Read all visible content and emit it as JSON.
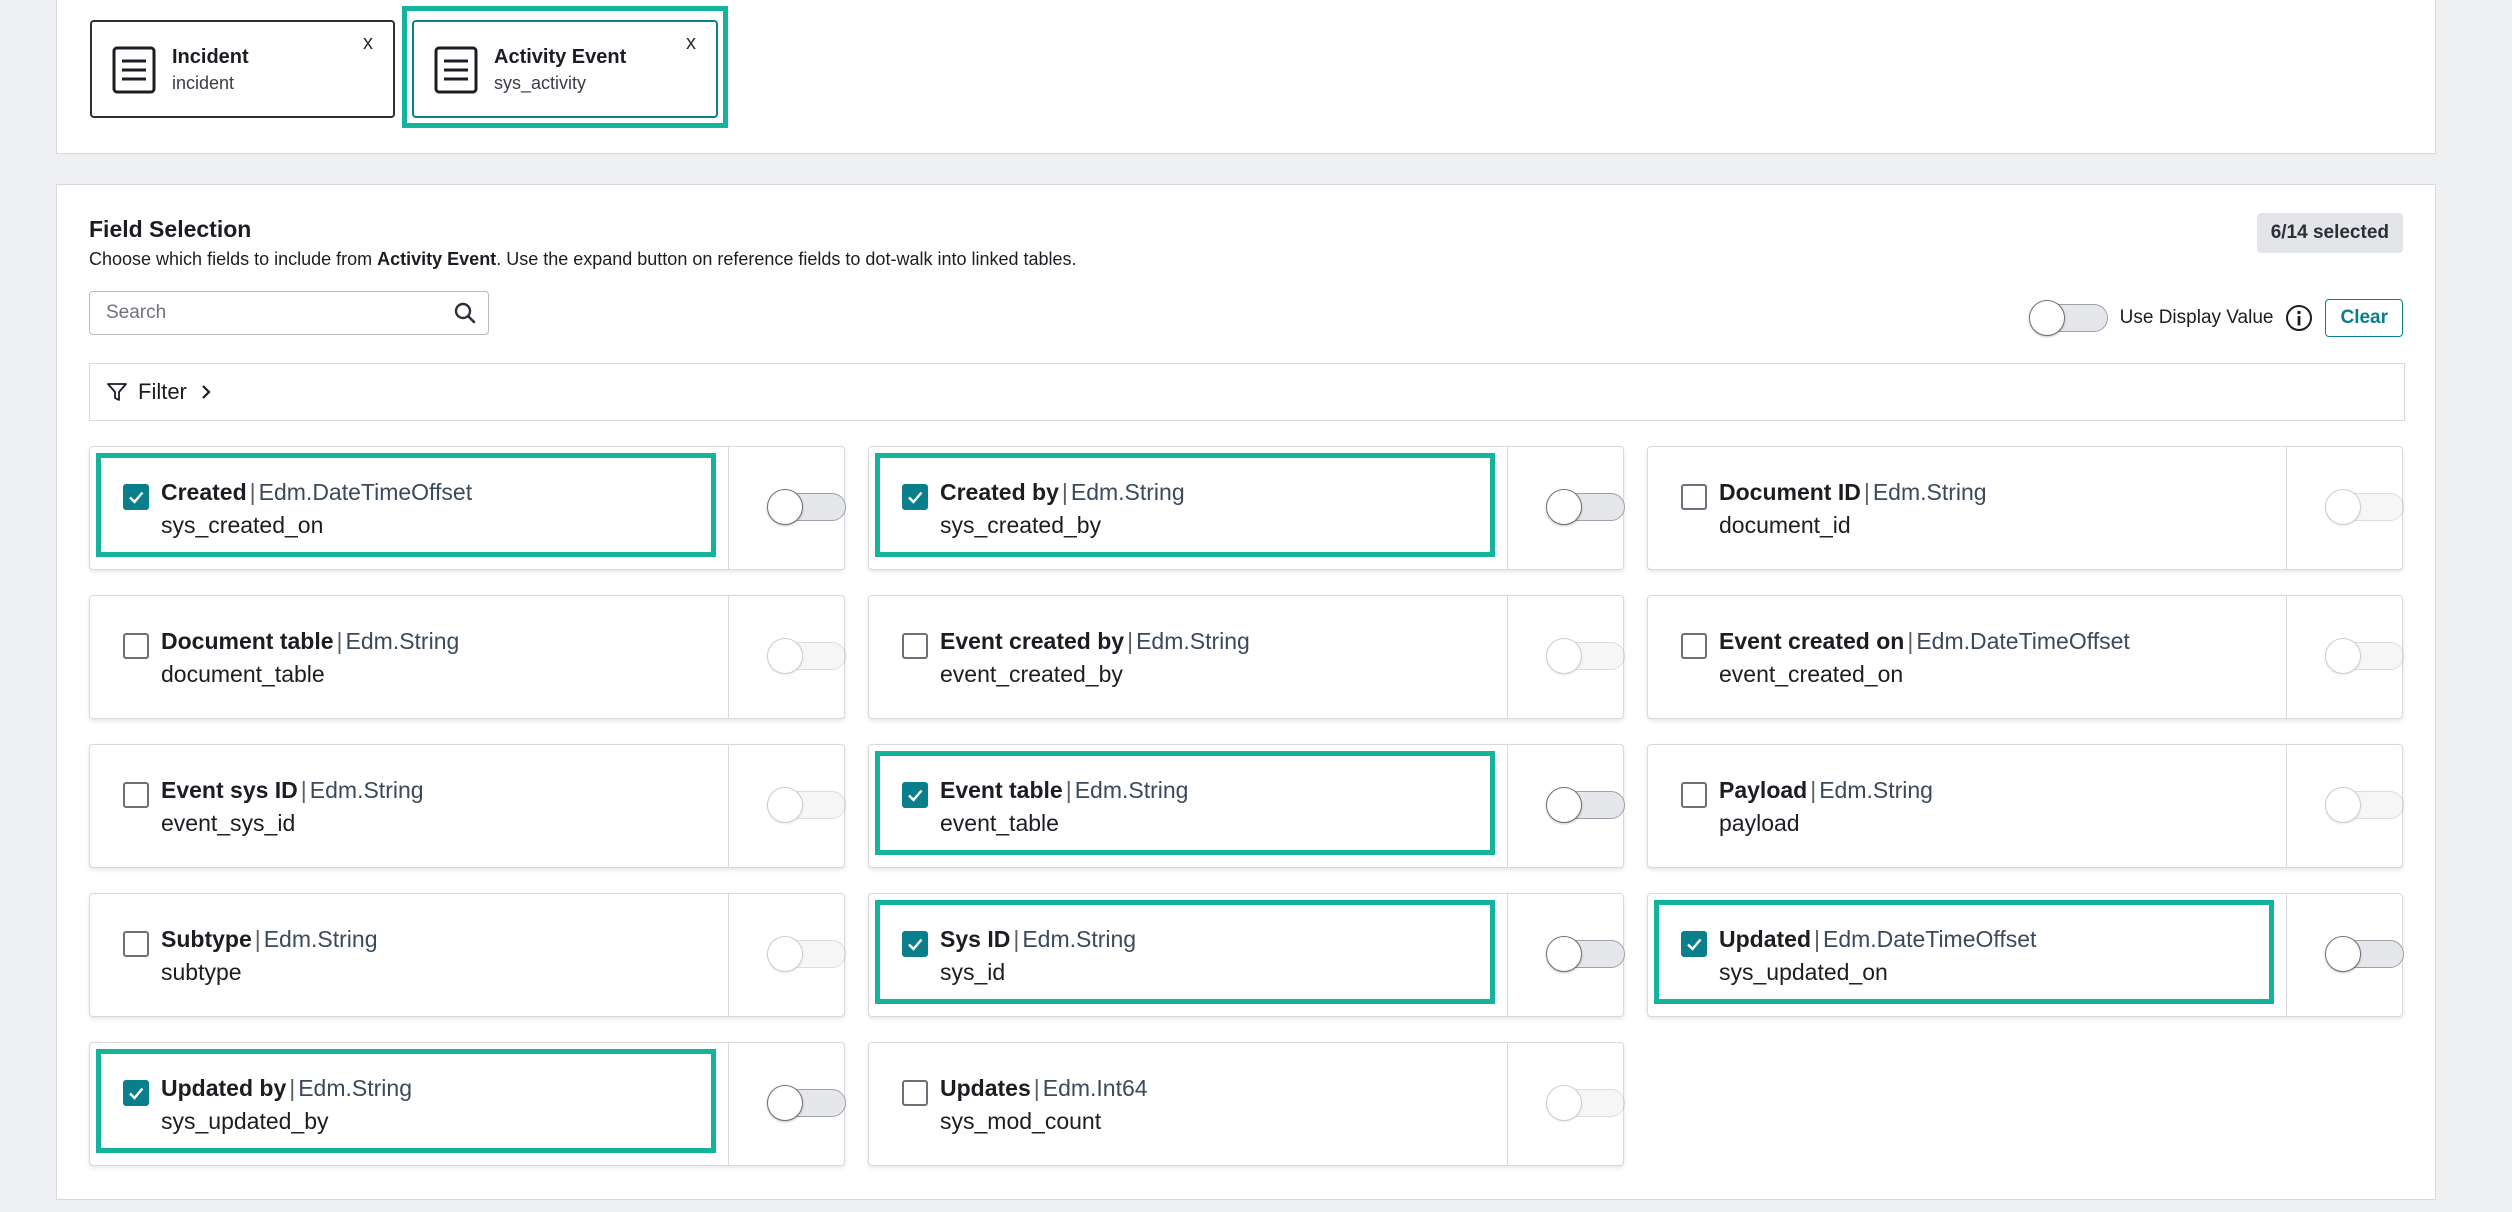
{
  "tables": [
    {
      "title": "Incident",
      "subtitle": "incident",
      "close": "x"
    },
    {
      "title": "Activity Event",
      "subtitle": "sys_activity",
      "close": "x"
    }
  ],
  "field_selection": {
    "title": "Field Selection",
    "description_prefix": "Choose which fields to include from ",
    "description_table": "Activity Event",
    "description_suffix": ". Use the expand button on reference fields to dot-walk into linked tables.",
    "selected_badge": "6/14 selected",
    "search_placeholder": "Search",
    "use_display_value_label": "Use Display Value",
    "clear_label": "Clear",
    "filter_label": "Filter"
  },
  "fields": [
    {
      "name": "Created",
      "sep": "|",
      "type": "Edm.DateTimeOffset",
      "key": "sys_created_on",
      "checked": true
    },
    {
      "name": "Created by",
      "sep": "|",
      "type": "Edm.String",
      "key": "sys_created_by",
      "checked": true
    },
    {
      "name": "Document ID",
      "sep": "|",
      "type": "Edm.String",
      "key": "document_id",
      "checked": false
    },
    {
      "name": "Document table",
      "sep": "|",
      "type": "Edm.String",
      "key": "document_table",
      "checked": false
    },
    {
      "name": "Event created by",
      "sep": "|",
      "type": "Edm.String",
      "key": "event_created_by",
      "checked": false
    },
    {
      "name": "Event created on",
      "sep": "|",
      "type": "Edm.DateTimeOffset",
      "key": "event_created_on",
      "checked": false
    },
    {
      "name": "Event sys ID",
      "sep": "|",
      "type": "Edm.String",
      "key": "event_sys_id",
      "checked": false
    },
    {
      "name": "Event table",
      "sep": "|",
      "type": "Edm.String",
      "key": "event_table",
      "checked": true
    },
    {
      "name": "Payload",
      "sep": "|",
      "type": "Edm.String",
      "key": "payload",
      "checked": false
    },
    {
      "name": "Subtype",
      "sep": "|",
      "type": "Edm.String",
      "key": "subtype",
      "checked": false
    },
    {
      "name": "Sys ID",
      "sep": "|",
      "type": "Edm.String",
      "key": "sys_id",
      "checked": true
    },
    {
      "name": "Updated",
      "sep": "|",
      "type": "Edm.DateTimeOffset",
      "key": "sys_updated_on",
      "checked": true
    },
    {
      "name": "Updated by",
      "sep": "|",
      "type": "Edm.String",
      "key": "sys_updated_by",
      "checked": true
    },
    {
      "name": "Updates",
      "sep": "|",
      "type": "Edm.Int64",
      "key": "sys_mod_count",
      "checked": false
    }
  ],
  "colors": {
    "accent": "#0a7f8c",
    "highlight": "#16b39c"
  }
}
